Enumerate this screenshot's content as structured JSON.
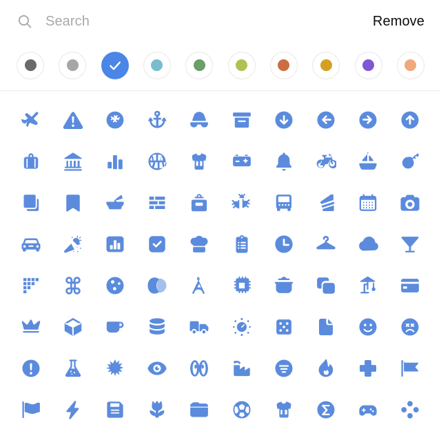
{
  "panel": {
    "background": "#ffffff",
    "accent": "#5b8bdd"
  },
  "search": {
    "placeholder": "Search",
    "value": "",
    "icon": "search-icon"
  },
  "toolbar": {
    "remove_label": "Remove"
  },
  "colors": {
    "selected_index": 2,
    "selected_color": "#4a86e8",
    "swatches": [
      {
        "name": "dark-gray",
        "hex": "#6a6a6a",
        "selected": false
      },
      {
        "name": "gray",
        "hex": "#a6a6a6",
        "selected": false
      },
      {
        "name": "blue",
        "hex": "#4a86e8",
        "selected": true
      },
      {
        "name": "teal",
        "hex": "#79bcd0",
        "selected": false
      },
      {
        "name": "green",
        "hex": "#6b9e68",
        "selected": false
      },
      {
        "name": "lime",
        "hex": "#b0c153",
        "selected": false
      },
      {
        "name": "orange-red",
        "hex": "#cb6f42",
        "selected": false
      },
      {
        "name": "gold",
        "hex": "#d4a021",
        "selected": false
      },
      {
        "name": "purple",
        "hex": "#7f57d4",
        "selected": false
      },
      {
        "name": "peach",
        "hex": "#f0a97a",
        "selected": false
      }
    ]
  },
  "icon_grid": {
    "columns": 10,
    "rows": 8,
    "color": "#5b8bdd",
    "icons": [
      "airplane",
      "warning-triangle",
      "american-football",
      "anchor",
      "disguise-glasses",
      "archive-box",
      "arrow-down-circle",
      "arrow-left-circle",
      "arrow-right-circle",
      "arrow-up-circle",
      "handbag",
      "bank",
      "bar-chart",
      "basketball",
      "basketball-jersey",
      "battery",
      "bell",
      "bicycle",
      "sailboat",
      "bomb",
      "books",
      "bookmark",
      "bowl-with-spoon",
      "brick-wall",
      "toolbox",
      "bug",
      "bus",
      "cake-slice",
      "calendar",
      "camera",
      "car",
      "party-popper",
      "chart-box",
      "checkbox-checked",
      "chef-hat",
      "clipboard",
      "clock",
      "clothes-hanger",
      "cloud",
      "cocktail-glass",
      "code-blocks",
      "command-key",
      "color-palette",
      "contrast-circles",
      "drawing-compass",
      "cpu-chip",
      "cooking-pot",
      "copy-squares",
      "crane",
      "credit-card",
      "crown",
      "cube",
      "coffee-mug",
      "database",
      "delivery-truck",
      "gauge-sparkle",
      "dice-five",
      "document-file",
      "smiley-face",
      "sad-face",
      "exclamation-circle",
      "flask",
      "explosion-star",
      "eye",
      "eyes-pair",
      "factory",
      "filter-circle",
      "flame",
      "medical-plus",
      "flag-banner",
      "flag-wavy",
      "lightning-bolt",
      "floppy-disk",
      "tulip-flower",
      "folder",
      "soccer-ball",
      "soccer-jersey",
      "sigma-circle",
      "game-controller",
      "dpad-buttons"
    ]
  }
}
